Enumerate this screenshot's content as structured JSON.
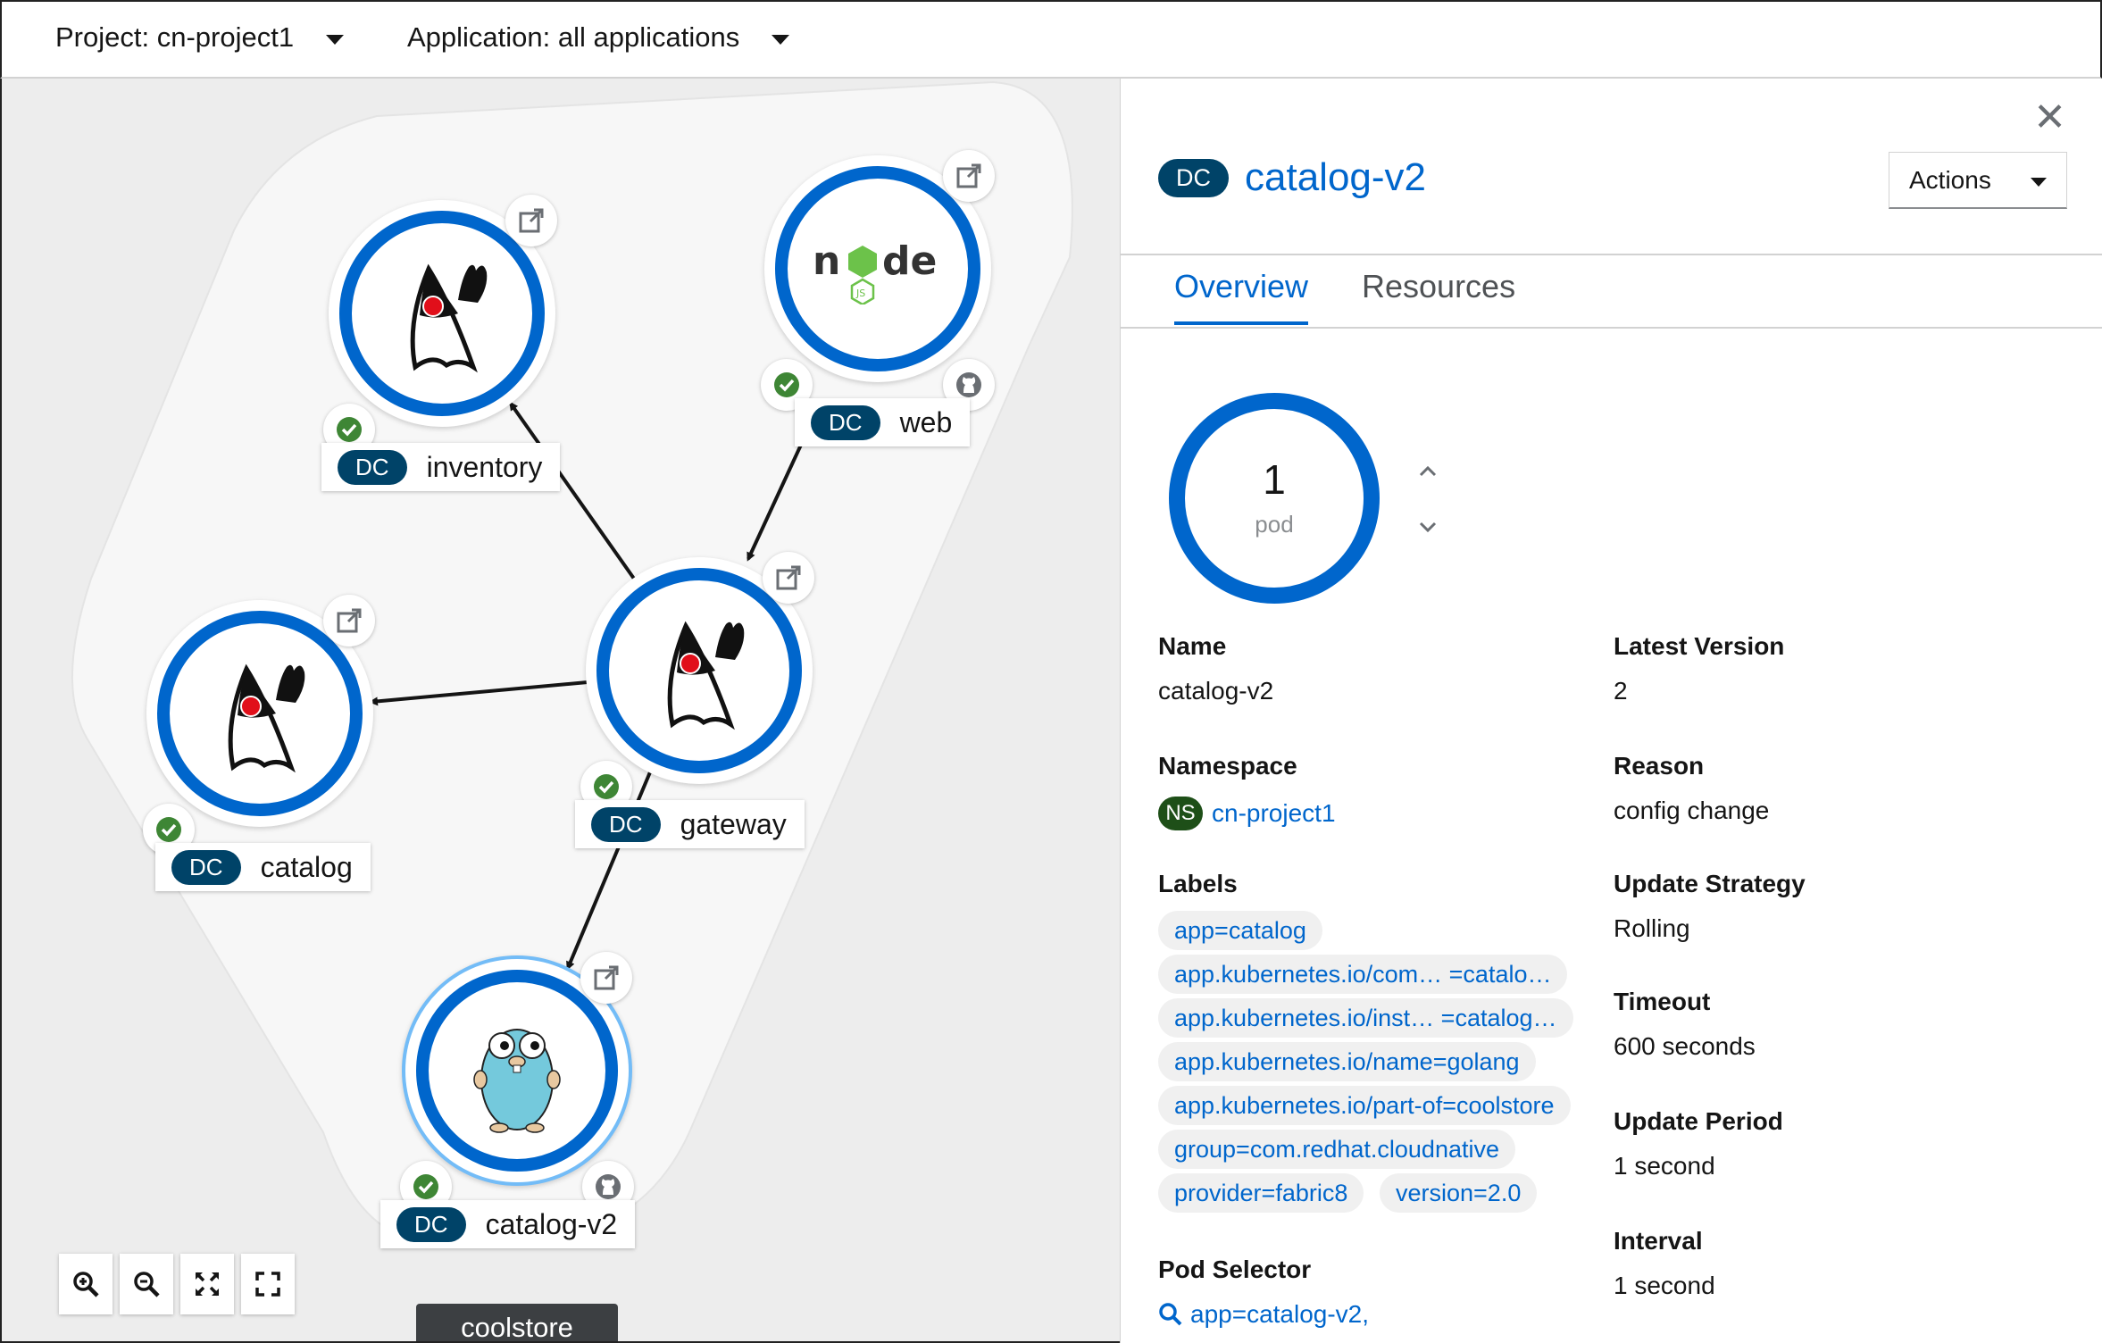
{
  "topbar": {
    "project_label": "Project: cn-project1",
    "application_label": "Application: all applications"
  },
  "topology": {
    "group_name": "coolstore",
    "nodes": {
      "inventory": {
        "kind": "DC",
        "name": "inventory",
        "icon": "java-duke-icon"
      },
      "web": {
        "kind": "DC",
        "name": "web",
        "icon": "nodejs-icon"
      },
      "gateway": {
        "kind": "DC",
        "name": "gateway",
        "icon": "java-duke-icon"
      },
      "catalog": {
        "kind": "DC",
        "name": "catalog",
        "icon": "java-duke-icon"
      },
      "catalog_v2": {
        "kind": "DC",
        "name": "catalog-v2",
        "icon": "golang-gopher-icon"
      }
    },
    "colors": {
      "ring": "#0066cc",
      "status_ok": "#3e8635",
      "badge_dark": "#004368"
    }
  },
  "panel": {
    "kind": "DC",
    "title": "catalog-v2",
    "actions_label": "Actions",
    "tabs": {
      "overview": "Overview",
      "resources": "Resources"
    },
    "pod_count": "1",
    "pod_unit": "pod",
    "name_key": "Name",
    "name_value": "catalog-v2",
    "namespace_key": "Namespace",
    "namespace_kind": "NS",
    "namespace_value": "cn-project1",
    "labels_key": "Labels",
    "labels": [
      "app=catalog",
      "app.kubernetes.io/com… =catalo…",
      "app.kubernetes.io/inst… =catalog…",
      "app.kubernetes.io/name=golang",
      "app.kubernetes.io/part-of=coolstore",
      "group=com.redhat.cloudnative",
      "provider=fabric8",
      "version=2.0"
    ],
    "pod_selector_key": "Pod Selector",
    "pod_selector_value": "app=catalog-v2,",
    "latest_version_key": "Latest Version",
    "latest_version_value": "2",
    "reason_key": "Reason",
    "reason_value": "config change",
    "update_strategy_key": "Update Strategy",
    "update_strategy_value": "Rolling",
    "timeout_key": "Timeout",
    "timeout_value": "600 seconds",
    "update_period_key": "Update Period",
    "update_period_value": "1 second",
    "interval_key": "Interval",
    "interval_value": "1 second"
  }
}
